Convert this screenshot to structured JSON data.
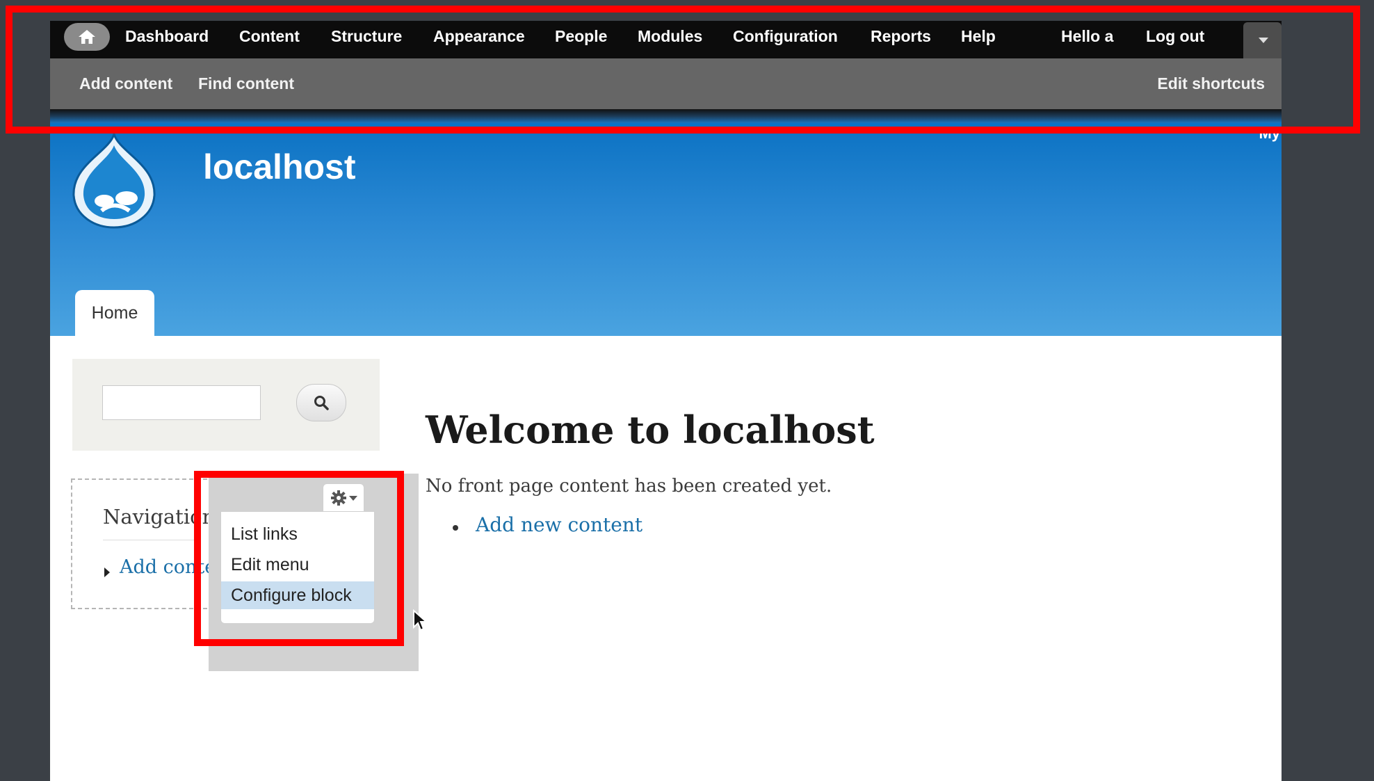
{
  "toolbar": {
    "nav_items": [
      "Dashboard",
      "Content",
      "Structure",
      "Appearance",
      "People",
      "Modules",
      "Configuration",
      "Reports",
      "Help"
    ],
    "user_greeting": "Hello a",
    "logout_label": "Log out",
    "shortcuts": [
      "Add content",
      "Find content"
    ],
    "edit_shortcuts_label": "Edit shortcuts"
  },
  "header": {
    "site_name": "localhost",
    "my_account_label": "My",
    "tabs": [
      "Home"
    ]
  },
  "sidebar": {
    "search": {
      "value": ""
    },
    "navigation_block": {
      "title": "Navigation",
      "link_label": "Add content"
    },
    "contextual_menu": {
      "items": [
        "List links",
        "Edit menu",
        "Configure block"
      ],
      "highlighted_item": "Configure block"
    }
  },
  "main": {
    "title": "Welcome to localhost",
    "message": "No front page content has been created yet.",
    "links": [
      "Add new content"
    ]
  },
  "colors": {
    "highlight": "#ff0000",
    "header_blue": "#1a7fcf",
    "link": "#1a6fa8",
    "toolbar_dark": "#0c0c0c"
  },
  "icons": [
    "home-icon",
    "drupal-logo-icon",
    "search-icon",
    "gear-icon",
    "chevron-down-icon",
    "mouse-cursor-icon"
  ]
}
